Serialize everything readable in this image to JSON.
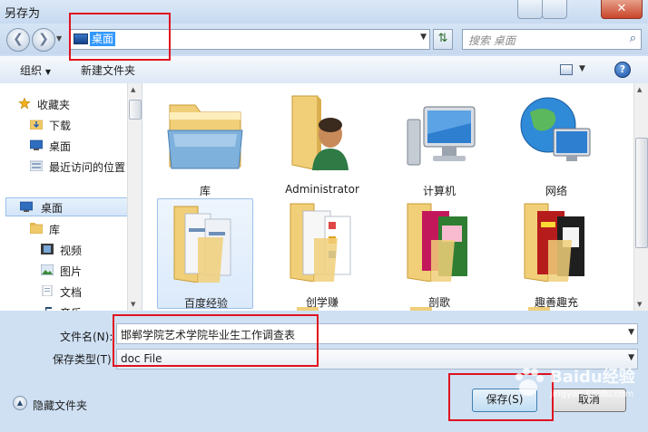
{
  "window": {
    "title": "另存为",
    "close_label": "✕"
  },
  "navigation": {
    "back_icon": "back-arrow-icon",
    "forward_icon": "forward-arrow-icon",
    "address_path": "桌面",
    "search_placeholder": "搜索 桌面"
  },
  "toolbar": {
    "organize_label": "组织",
    "new_folder_label": "新建文件夹",
    "help_label": "?"
  },
  "sidebar": {
    "items": [
      {
        "label": "收藏夹",
        "icon": "star-icon"
      },
      {
        "label": "下载",
        "icon": "download-folder-icon"
      },
      {
        "label": "桌面",
        "icon": "desktop-icon"
      },
      {
        "label": "最近访问的位置",
        "icon": "recent-places-icon"
      },
      {
        "label": "桌面",
        "icon": "desktop-icon"
      },
      {
        "label": "库",
        "icon": "library-icon"
      },
      {
        "label": "视频",
        "icon": "video-icon"
      },
      {
        "label": "图片",
        "icon": "picture-icon"
      },
      {
        "label": "文档",
        "icon": "document-icon"
      },
      {
        "label": "音乐",
        "icon": "music-icon"
      }
    ]
  },
  "files": {
    "items": [
      {
        "label": "库",
        "icon": "library-folder-icon"
      },
      {
        "label": "Administrator",
        "icon": "user-folder-icon"
      },
      {
        "label": "计算机",
        "icon": "computer-icon"
      },
      {
        "label": "网络",
        "icon": "network-globe-icon"
      },
      {
        "label": "百度经验",
        "icon": "folder-icon"
      },
      {
        "label": "创学赚",
        "icon": "folder-icon"
      },
      {
        "label": "剖歌",
        "icon": "folder-icon"
      },
      {
        "label": "趣善趣充",
        "icon": "folder-icon"
      }
    ]
  },
  "form": {
    "filename_label": "文件名(N):",
    "filename_value": "邯郸学院艺术学院毕业生工作调查表",
    "filetype_label": "保存类型(T):",
    "filetype_value": "doc File"
  },
  "footer": {
    "hide_folders_label": "隐藏文件夹",
    "save_label": "保存(S)",
    "cancel_label": "取消"
  },
  "watermark": {
    "text": "Baidu经验",
    "subtext": "jingyan.baidu.com"
  },
  "colors": {
    "highlight_box": "#e0121f",
    "selection": "#3399ff"
  }
}
